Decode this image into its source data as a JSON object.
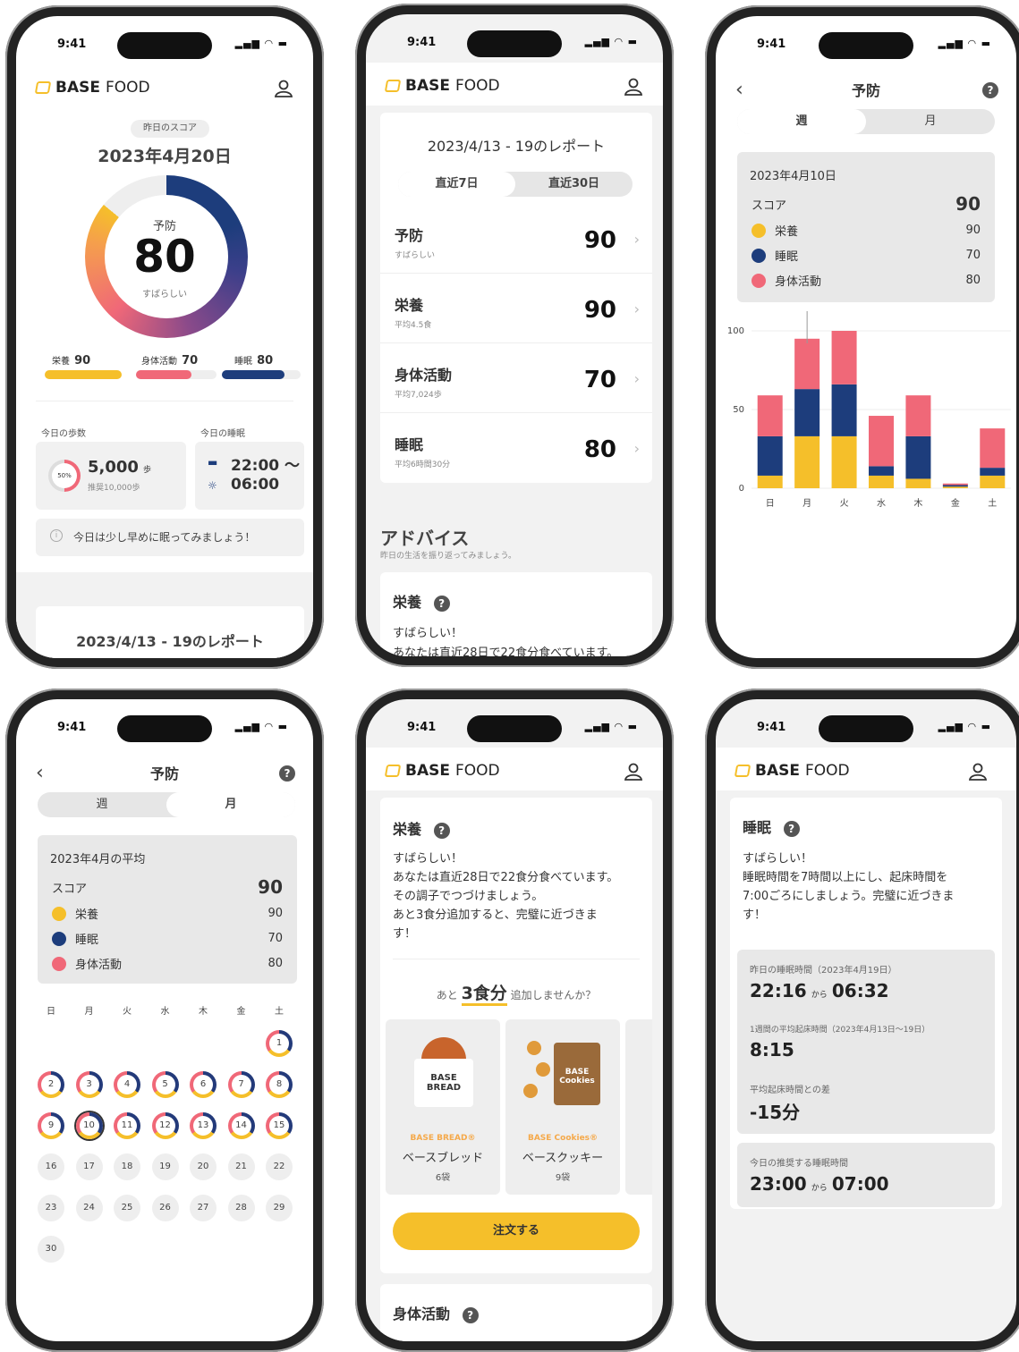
{
  "status": {
    "time": "9:41"
  },
  "brand": {
    "base": "BASE",
    "food": "FOOD",
    "accent": "#f5bf2a",
    "navy": "#1d3d7c",
    "pink": "#f06878"
  },
  "home": {
    "score_badge": "昨日のスコア",
    "date": "2023年4月20日",
    "ring_label": "予防",
    "ring_score": "80",
    "ring_sub": "すばらしい",
    "metrics": [
      {
        "label": "栄養",
        "value": "90"
      },
      {
        "label": "身体活動",
        "value": "70"
      },
      {
        "label": "睡眠",
        "value": "80"
      }
    ],
    "steps_title": "今日の歩数",
    "steps_pct": "50%",
    "steps_value": "5,000",
    "steps_unit": "歩",
    "steps_sub": "推奨10,000歩",
    "sleep_title": "今日の睡眠",
    "sleep_start": "22:00 〜",
    "sleep_end": "06:00",
    "tip": "今日は少し早めに眠ってみましょう！",
    "report_title": "2023/4/13 - 19のレポート"
  },
  "report": {
    "title": "2023/4/13 - 19のレポート",
    "tabs": [
      "直近7日",
      "直近30日"
    ],
    "rows": [
      {
        "title": "予防",
        "sub": "すばらしい",
        "value": "90"
      },
      {
        "title": "栄養",
        "sub": "平均4.5食",
        "value": "90"
      },
      {
        "title": "身体活動",
        "sub": "平均7,024歩",
        "value": "70"
      },
      {
        "title": "睡眠",
        "sub": "平均6時間30分",
        "value": "80"
      }
    ],
    "advice_title": "アドバイス",
    "advice_sub": "昨日の生活を振り返ってみましょう。",
    "nutrition_title": "栄養",
    "nutrition_line1": "すばらしい！",
    "nutrition_line2": "あなたは直近28日で22食分食べています。"
  },
  "weekly": {
    "title": "予防",
    "tabs": [
      "週",
      "月"
    ],
    "date": "2023年4月10日",
    "score_label": "スコア",
    "score": "90",
    "legend": [
      {
        "label": "栄養",
        "value": "90"
      },
      {
        "label": "睡眠",
        "value": "70"
      },
      {
        "label": "身体活動",
        "value": "80"
      }
    ]
  },
  "chart_data": {
    "type": "bar",
    "stacked": true,
    "categories": [
      "日",
      "月",
      "火",
      "水",
      "木",
      "金",
      "土"
    ],
    "ylim": [
      0,
      100
    ],
    "yticks": [
      "0",
      "50",
      "100"
    ],
    "series": [
      {
        "name": "栄養",
        "color": "#f5bf2a",
        "values": [
          8,
          33,
          33,
          8,
          6,
          1,
          8
        ]
      },
      {
        "name": "睡眠",
        "color": "#1d3d7c",
        "values": [
          25,
          30,
          33,
          6,
          27,
          1,
          5
        ]
      },
      {
        "name": "身体活動",
        "color": "#f06878",
        "values": [
          26,
          32,
          34,
          32,
          26,
          1,
          25
        ]
      }
    ]
  },
  "monthly": {
    "title": "予防",
    "tabs": [
      "週",
      "月"
    ],
    "heading": "2023年4月の平均",
    "score_label": "スコア",
    "score": "90",
    "legend": [
      {
        "label": "栄養",
        "value": "90"
      },
      {
        "label": "睡眠",
        "value": "70"
      },
      {
        "label": "身体活動",
        "value": "80"
      }
    ],
    "weekdays": [
      "日",
      "月",
      "火",
      "水",
      "木",
      "金",
      "土"
    ],
    "days": [
      "1",
      "2",
      "3",
      "4",
      "5",
      "6",
      "7",
      "8",
      "9",
      "10",
      "11",
      "12",
      "13",
      "14",
      "15",
      "16",
      "17",
      "18",
      "19",
      "20",
      "21",
      "22",
      "23",
      "24",
      "25",
      "26",
      "27",
      "28",
      "29",
      "30"
    ]
  },
  "nutrition": {
    "title": "栄養",
    "lines": [
      "すばらしい！",
      "あなたは直近28日で22食分食べています。",
      "その調子でつづけましょう。",
      "あと3食分追加すると、完璧に近づきま",
      "す！"
    ],
    "cta_pre": "あと",
    "cta_num": "3食分",
    "cta_post": "追加しませんか？",
    "products": [
      {
        "brand": "BASE BREAD®",
        "name": "ベースブレッド",
        "qty": "6袋",
        "pkg": "BASE BREAD"
      },
      {
        "brand": "BASE Cookies®",
        "name": "ベースクッキー",
        "qty": "9袋",
        "pkg": "BASE Cookies"
      }
    ],
    "order": "注文する",
    "next_title": "身体活動"
  },
  "sleep": {
    "title": "睡眠",
    "lines": [
      "すばらしい！",
      "睡眠時間を7時間以上にし、起床時間を",
      "7:00ごろにしましょう。完璧に近づきま",
      "す！"
    ],
    "last_label": "昨日の睡眠時間（2023年4月19日）",
    "last_from": "22:16",
    "last_to": "06:32",
    "avg_label": "1週間の平均起床時間（2023年4月13日〜19日）",
    "avg_value": "8:15",
    "diff_label": "平均起床時間との差",
    "diff_value": "-15分",
    "rec_label": "今日の推奨する睡眠時間",
    "rec_from": "23:00",
    "rec_to": "07:00",
    "kara": "から"
  }
}
